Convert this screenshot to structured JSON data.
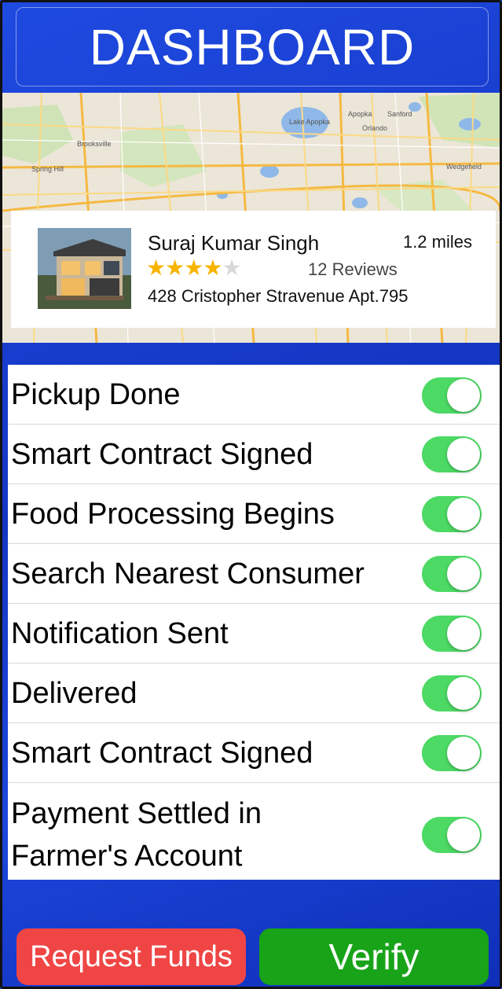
{
  "header": {
    "title": "DASHBOARD"
  },
  "map": {
    "labels": [
      "Lake Apopka",
      "Orlando",
      "Spring Hill",
      "Brooksville",
      "Wedgefield",
      "Apopka",
      "Sanford"
    ]
  },
  "profile": {
    "name": "Suraj Kumar Singh",
    "distance": "1.2 miles",
    "rating": 4,
    "rating_max": 5,
    "reviews": "12 Reviews",
    "address": "428 Cristopher Stravenue Apt.795",
    "photo_icon": "house-photo"
  },
  "steps": [
    {
      "label": "Pickup Done",
      "on": true
    },
    {
      "label": "Smart Contract Signed",
      "on": true
    },
    {
      "label": "Food Processing Begins",
      "on": true
    },
    {
      "label": "Search Nearest Consumer",
      "on": true
    },
    {
      "label": "Notification Sent",
      "on": true
    },
    {
      "label": "Delivered",
      "on": true
    },
    {
      "label": "Smart Contract Signed",
      "on": true
    },
    {
      "label": "Payment Settled in",
      "label2": "Farmer's Account",
      "on": true
    }
  ],
  "buttons": {
    "request_funds": "Request Funds",
    "verify": "Verify"
  },
  "colors": {
    "background": "#1a3fd6",
    "toggle_on": "#4cd964",
    "request_button": "#f04545",
    "verify_button": "#18a318",
    "star": "#f7b500"
  }
}
